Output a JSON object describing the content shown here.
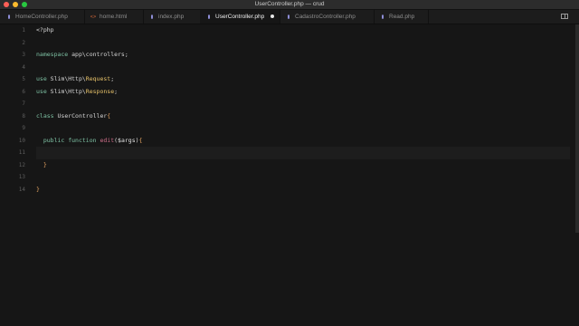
{
  "window": {
    "title": "UserController.php — crud"
  },
  "tabs": [
    {
      "label": "HomeController.php",
      "icon": "php-icon"
    },
    {
      "label": "home.html",
      "icon": "html-icon"
    },
    {
      "label": "index.php",
      "icon": "php-icon"
    },
    {
      "label": "UserController.php",
      "icon": "php-icon",
      "active": true,
      "modified": true
    },
    {
      "label": "CadastroController.php",
      "icon": "php-icon"
    },
    {
      "label": "Read.php",
      "icon": "php-icon"
    }
  ],
  "editor": {
    "line_numbers": [
      "1",
      "2",
      "3",
      "4",
      "5",
      "6",
      "7",
      "8",
      "9",
      "10",
      "11",
      "12",
      "13",
      "14"
    ],
    "code": {
      "l1": "<?php",
      "l3_kw": "namespace",
      "l3_rest": " app\\controllers;",
      "l5_kw": "use",
      "l5_ns": " Slim\\Http\\",
      "l5_cls": "Request",
      "l5_end": ";",
      "l6_kw": "use",
      "l6_ns": " Slim\\Http\\",
      "l6_cls": "Response",
      "l6_end": ";",
      "l8_kw": "class",
      "l8_name": " UserController",
      "l8_brace": "{",
      "l10_indent": "  ",
      "l10_kw1": "public",
      "l10_kw2": " function",
      "l10_fn": " edit",
      "l10_paren_open": "(",
      "l10_arg": "$args",
      "l10_paren_close": ")",
      "l10_brace": "{",
      "l12_indent": "  ",
      "l12_brace": "}",
      "l14_brace": "}"
    }
  },
  "colors": {
    "background": "#161616",
    "keyword": "#7ec2a4",
    "class": "#e8c36a",
    "function": "#cf6f8a",
    "brace": "#e0a060"
  }
}
